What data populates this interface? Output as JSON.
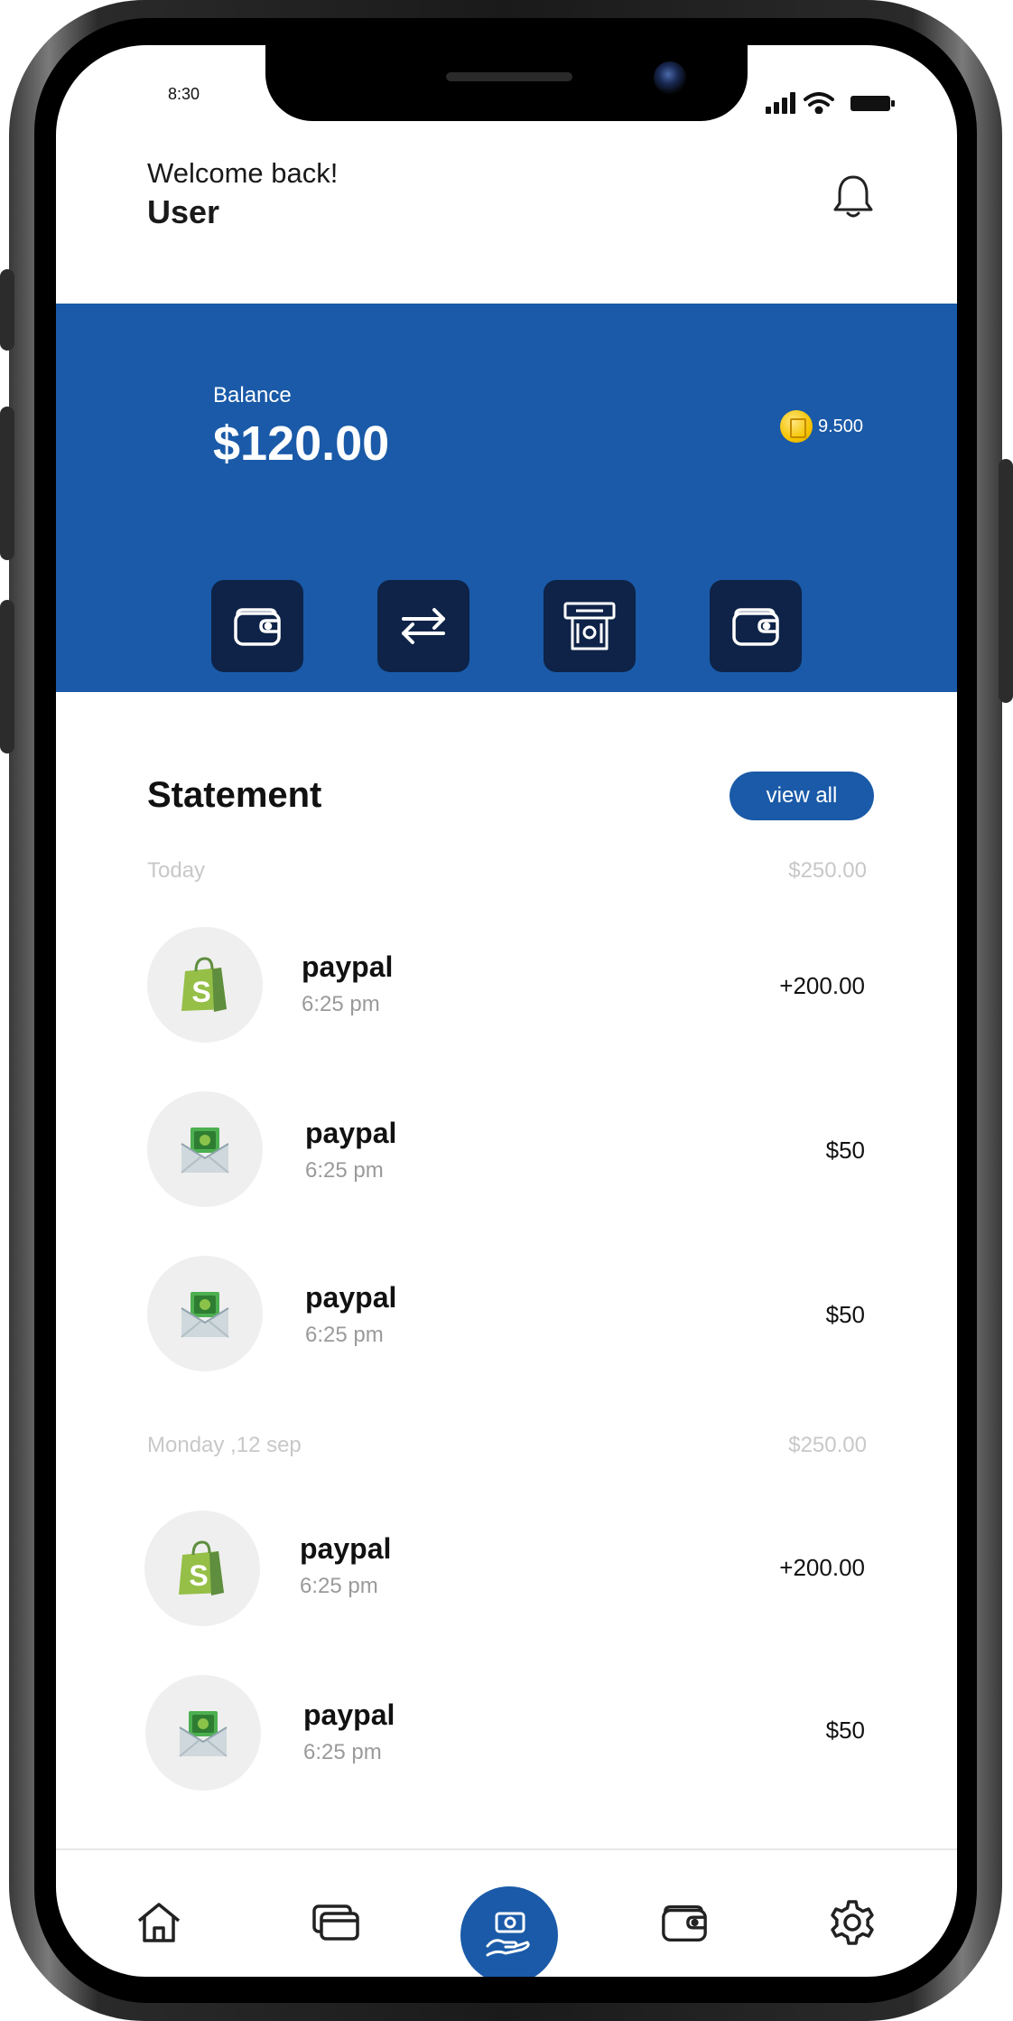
{
  "status": {
    "time": "8:30",
    "icons": [
      "signal-icon",
      "wifi-icon",
      "battery-icon"
    ]
  },
  "header": {
    "greeting": "Welcome back!",
    "username": "User",
    "notification_icon": "bell-icon"
  },
  "balance": {
    "label": "Balance",
    "amount": "$120.00",
    "coins": "9.500",
    "card_color": "#1a5aa8",
    "actions": [
      {
        "icon": "wallet-icon"
      },
      {
        "icon": "transfer-icon"
      },
      {
        "icon": "atm-withdraw-icon"
      },
      {
        "icon": "wallet-icon"
      }
    ]
  },
  "statement": {
    "title": "Statement",
    "view_all_label": "view all",
    "groups": [
      {
        "label": "Today",
        "total": "$250.00",
        "transactions": [
          {
            "icon": "shopify-bag-icon",
            "name": "paypal",
            "time": "6:25 pm",
            "amount": "+200.00"
          },
          {
            "icon": "money-envelope-icon",
            "name": "paypal",
            "time": "6:25 pm",
            "amount": "$50"
          },
          {
            "icon": "money-envelope-icon",
            "name": "paypal",
            "time": "6:25 pm",
            "amount": "$50"
          }
        ]
      },
      {
        "label": "Monday ,12 sep",
        "total": "$250.00",
        "transactions": [
          {
            "icon": "shopify-bag-icon",
            "name": "paypal",
            "time": "6:25 pm",
            "amount": "+200.00"
          },
          {
            "icon": "money-envelope-icon",
            "name": "paypal",
            "time": "6:25 pm",
            "amount": "$50"
          }
        ]
      }
    ]
  },
  "nav": {
    "items": [
      "home-icon",
      "cards-icon",
      "money-hand-icon",
      "wallet-icon",
      "settings-icon"
    ],
    "active": "money-hand-icon",
    "accent": "#1a5aa8"
  }
}
